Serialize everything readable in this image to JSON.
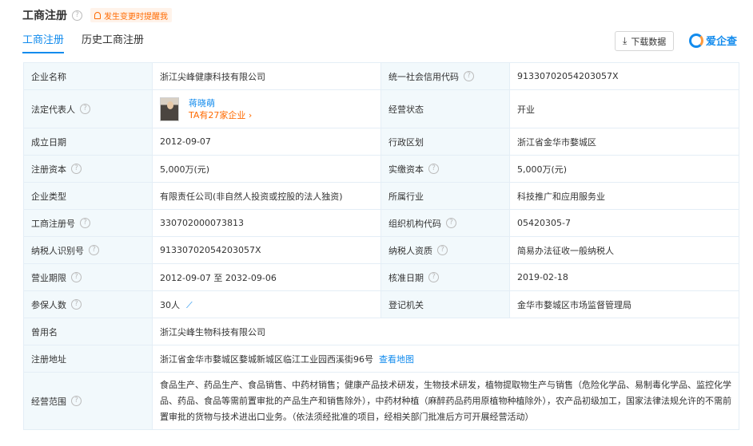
{
  "header": {
    "title": "工商注册",
    "remind": "发生变更时提醒我"
  },
  "tabs": [
    {
      "label": "工商注册"
    },
    {
      "label": "历史工商注册"
    }
  ],
  "toolbar": {
    "download_label": "下载数据",
    "logo_text": "爱企查"
  },
  "rows": {
    "company_name": {
      "label": "企业名称",
      "value": "浙江尖峰健康科技有限公司"
    },
    "credit_code": {
      "label": "统一社会信用代码",
      "value": "91330702054203057X"
    },
    "legal_rep": {
      "label": "法定代表人",
      "name": "蒋晓萌",
      "sub": "TA有27家企业 ›"
    },
    "status": {
      "label": "经营状态",
      "value": "开业"
    },
    "found_date": {
      "label": "成立日期",
      "value": "2012-09-07"
    },
    "region": {
      "label": "行政区划",
      "value": "浙江省金华市婺城区"
    },
    "reg_capital": {
      "label": "注册资本",
      "value": "5,000万(元)"
    },
    "paid_capital": {
      "label": "实缴资本",
      "value": "5,000万(元)"
    },
    "company_type": {
      "label": "企业类型",
      "value": "有限责任公司(非自然人投资或控股的法人独资)"
    },
    "industry": {
      "label": "所属行业",
      "value": "科技推广和应用服务业"
    },
    "reg_no": {
      "label": "工商注册号",
      "value": "330702000073813"
    },
    "org_code": {
      "label": "组织机构代码",
      "value": "05420305-7"
    },
    "tax_id": {
      "label": "纳税人识别号",
      "value": "91330702054203057X"
    },
    "tax_qual": {
      "label": "纳税人资质",
      "value": "简易办法征收一般纳税人"
    },
    "term": {
      "label": "营业期限",
      "value": "2012-09-07 至 2032-09-06"
    },
    "approve_date": {
      "label": "核准日期",
      "value": "2019-02-18"
    },
    "insured": {
      "label": "参保人数",
      "value": "30人"
    },
    "authority": {
      "label": "登记机关",
      "value": "金华市婺城区市场监督管理局"
    },
    "former_name": {
      "label": "曾用名",
      "value": "浙江尖峰生物科技有限公司"
    },
    "address": {
      "label": "注册地址",
      "value": "浙江省金华市婺城区婺城新城区临江工业园西溪街96号",
      "link": "查看地图"
    },
    "scope": {
      "label": "经营范围",
      "value": "食品生产、药品生产、食品销售、中药材销售；健康产品技术研发，生物技术研发，植物提取物生产与销售（危险化学品、易制毒化学品、监控化学品、药品、食品等需前置审批的产品生产和销售除外），中药材种植（麻醉药品药用原植物种植除外），农产品初级加工，国家法律法规允许的不需前置审批的货物与技术进出口业务。（依法须经批准的项目，经相关部门批准后方可开展经营活动）"
    }
  },
  "icons": {
    "question": "?",
    "download": "⤓",
    "trend": "📈"
  }
}
